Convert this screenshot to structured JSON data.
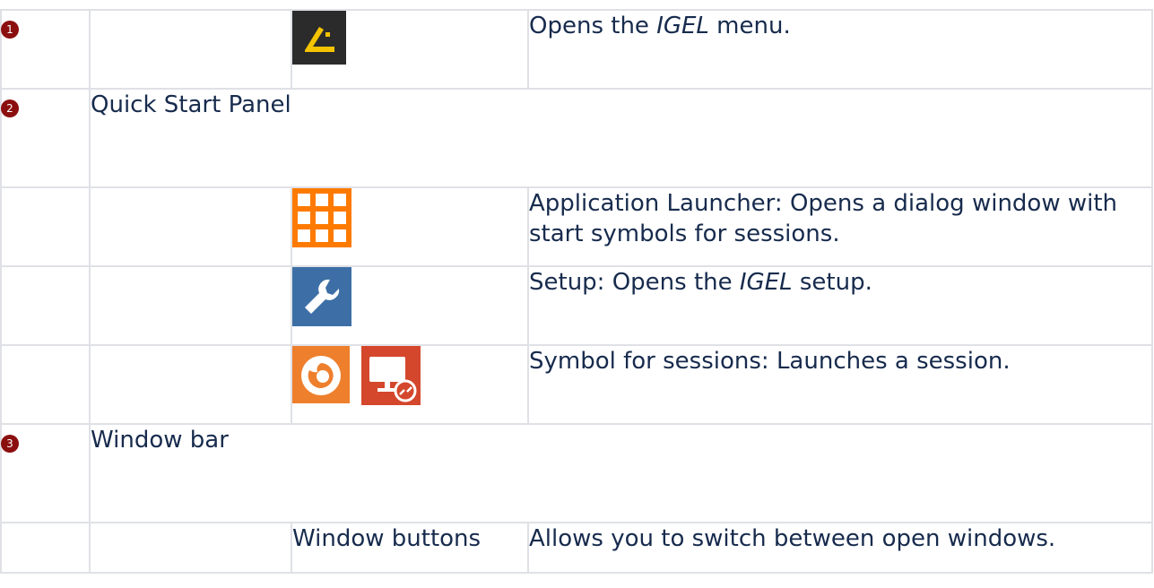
{
  "rows": [
    {
      "badge": "1",
      "icons": [
        "igel-menu-icon"
      ],
      "desc_pre": "Opens the ",
      "desc_em": "IGEL",
      "desc_post": " menu."
    },
    {
      "badge": "2",
      "section_title": "Quick Start Panel"
    },
    {
      "icons": [
        "application-launcher-icon"
      ],
      "desc": "Application Launcher: Opens a dialog window with start symbols for sessions."
    },
    {
      "icons": [
        "setup-wrench-icon"
      ],
      "desc_pre": "Setup: Opens the ",
      "desc_em": "IGEL",
      "desc_post": " setup."
    },
    {
      "icons": [
        "firefox-session-icon",
        "remote-desktop-session-icon"
      ],
      "desc": "Symbol for sessions: Launches a session."
    },
    {
      "badge": "3",
      "section_title": "Window bar"
    },
    {
      "label": "Window buttons",
      "desc": "Allows you to switch between open windows."
    }
  ],
  "colors": {
    "badge": "#8b0f0f",
    "border": "#dfe1e6",
    "text": "#172b4d",
    "igel_bg": "#2b2b2b",
    "igel_accent": "#f5c400",
    "launcher_orange": "#ff7a00",
    "setup_blue": "#3d6fa6",
    "firefox_orange": "#ee7f2d",
    "rdp_red": "#d4472c"
  }
}
